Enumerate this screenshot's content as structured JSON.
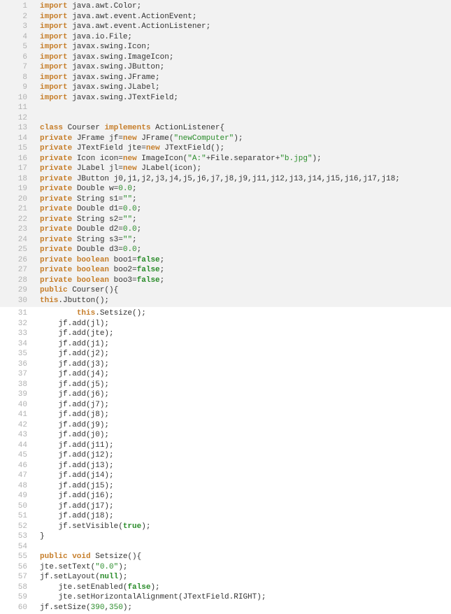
{
  "lines": [
    {
      "n": 1,
      "shaded": true,
      "indent": 0,
      "tokens": [
        [
          "kw",
          "import"
        ],
        [
          "plain",
          " java.awt.Color;"
        ]
      ]
    },
    {
      "n": 2,
      "shaded": true,
      "indent": 0,
      "tokens": [
        [
          "kw",
          "import"
        ],
        [
          "plain",
          " java.awt.event.ActionEvent;"
        ]
      ]
    },
    {
      "n": 3,
      "shaded": true,
      "indent": 0,
      "tokens": [
        [
          "kw",
          "import"
        ],
        [
          "plain",
          " java.awt.event.ActionListener;"
        ]
      ]
    },
    {
      "n": 4,
      "shaded": true,
      "indent": 0,
      "tokens": [
        [
          "kw",
          "import"
        ],
        [
          "plain",
          " java.io.File;"
        ]
      ]
    },
    {
      "n": 5,
      "shaded": true,
      "indent": 0,
      "tokens": [
        [
          "kw",
          "import"
        ],
        [
          "plain",
          " javax.swing.Icon;"
        ]
      ]
    },
    {
      "n": 6,
      "shaded": true,
      "indent": 0,
      "tokens": [
        [
          "kw",
          "import"
        ],
        [
          "plain",
          " javax.swing.ImageIcon;"
        ]
      ]
    },
    {
      "n": 7,
      "shaded": true,
      "indent": 0,
      "tokens": [
        [
          "kw",
          "import"
        ],
        [
          "plain",
          " javax.swing.JButton;"
        ]
      ]
    },
    {
      "n": 8,
      "shaded": true,
      "indent": 0,
      "tokens": [
        [
          "kw",
          "import"
        ],
        [
          "plain",
          " javax.swing.JFrame;"
        ]
      ]
    },
    {
      "n": 9,
      "shaded": true,
      "indent": 0,
      "tokens": [
        [
          "kw",
          "import"
        ],
        [
          "plain",
          " javax.swing.JLabel;"
        ]
      ]
    },
    {
      "n": 10,
      "shaded": true,
      "indent": 0,
      "tokens": [
        [
          "kw",
          "import"
        ],
        [
          "plain",
          " javax.swing.JTextField;"
        ]
      ]
    },
    {
      "n": 11,
      "shaded": true,
      "indent": 0,
      "tokens": []
    },
    {
      "n": 12,
      "shaded": true,
      "indent": 0,
      "tokens": []
    },
    {
      "n": 13,
      "shaded": true,
      "indent": 0,
      "tokens": [
        [
          "kw",
          "class"
        ],
        [
          "plain",
          " Courser "
        ],
        [
          "kw",
          "implements"
        ],
        [
          "plain",
          " ActionListener{"
        ]
      ]
    },
    {
      "n": 14,
      "shaded": true,
      "indent": 0,
      "tokens": [
        [
          "kw",
          "private"
        ],
        [
          "plain",
          " JFrame jf="
        ],
        [
          "kw",
          "new"
        ],
        [
          "plain",
          " JFrame("
        ],
        [
          "str",
          "\"newComputer\""
        ],
        [
          "plain",
          ");"
        ]
      ]
    },
    {
      "n": 15,
      "shaded": true,
      "indent": 0,
      "tokens": [
        [
          "kw",
          "private"
        ],
        [
          "plain",
          " JTextField jte="
        ],
        [
          "kw",
          "new"
        ],
        [
          "plain",
          " JTextField();"
        ]
      ]
    },
    {
      "n": 16,
      "shaded": true,
      "indent": 0,
      "tokens": [
        [
          "kw",
          "private"
        ],
        [
          "plain",
          " Icon icon="
        ],
        [
          "kw",
          "new"
        ],
        [
          "plain",
          " ImageIcon("
        ],
        [
          "str",
          "\"A:\""
        ],
        [
          "plain",
          "+File.separator+"
        ],
        [
          "str",
          "\"b.jpg\""
        ],
        [
          "plain",
          ");"
        ]
      ]
    },
    {
      "n": 17,
      "shaded": true,
      "indent": 0,
      "tokens": [
        [
          "kw",
          "private"
        ],
        [
          "plain",
          " JLabel jl="
        ],
        [
          "kw",
          "new"
        ],
        [
          "plain",
          " JLabel(icon);"
        ]
      ]
    },
    {
      "n": 18,
      "shaded": true,
      "indent": 0,
      "tokens": [
        [
          "kw",
          "private"
        ],
        [
          "plain",
          " JButton j0,j1,j2,j3,j4,j5,j6,j7,j8,j9,j11,j12,j13,j14,j15,j16,j17,j18;"
        ]
      ]
    },
    {
      "n": 19,
      "shaded": true,
      "indent": 0,
      "tokens": [
        [
          "kw",
          "private"
        ],
        [
          "plain",
          " Double w="
        ],
        [
          "num",
          "0.0"
        ],
        [
          "plain",
          ";"
        ]
      ]
    },
    {
      "n": 20,
      "shaded": true,
      "indent": 0,
      "tokens": [
        [
          "kw",
          "private"
        ],
        [
          "plain",
          " String s1="
        ],
        [
          "str",
          "\"\""
        ],
        [
          "plain",
          ";"
        ]
      ]
    },
    {
      "n": 21,
      "shaded": true,
      "indent": 0,
      "tokens": [
        [
          "kw",
          "private"
        ],
        [
          "plain",
          " Double d1="
        ],
        [
          "num",
          "0.0"
        ],
        [
          "plain",
          ";"
        ]
      ]
    },
    {
      "n": 22,
      "shaded": true,
      "indent": 0,
      "tokens": [
        [
          "kw",
          "private"
        ],
        [
          "plain",
          " String s2="
        ],
        [
          "str",
          "\"\""
        ],
        [
          "plain",
          ";"
        ]
      ]
    },
    {
      "n": 23,
      "shaded": true,
      "indent": 0,
      "tokens": [
        [
          "kw",
          "private"
        ],
        [
          "plain",
          " Double d2="
        ],
        [
          "num",
          "0.0"
        ],
        [
          "plain",
          ";"
        ]
      ]
    },
    {
      "n": 24,
      "shaded": true,
      "indent": 0,
      "tokens": [
        [
          "kw",
          "private"
        ],
        [
          "plain",
          " String s3="
        ],
        [
          "str",
          "\"\""
        ],
        [
          "plain",
          ";"
        ]
      ]
    },
    {
      "n": 25,
      "shaded": true,
      "indent": 0,
      "tokens": [
        [
          "kw",
          "private"
        ],
        [
          "plain",
          " Double d3="
        ],
        [
          "num",
          "0.0"
        ],
        [
          "plain",
          ";"
        ]
      ]
    },
    {
      "n": 26,
      "shaded": true,
      "indent": 0,
      "tokens": [
        [
          "kw",
          "private boolean"
        ],
        [
          "plain",
          " boo1="
        ],
        [
          "bool",
          "false"
        ],
        [
          "plain",
          ";"
        ]
      ]
    },
    {
      "n": 27,
      "shaded": true,
      "indent": 0,
      "tokens": [
        [
          "kw",
          "private boolean"
        ],
        [
          "plain",
          " boo2="
        ],
        [
          "bool",
          "false"
        ],
        [
          "plain",
          ";"
        ]
      ]
    },
    {
      "n": 28,
      "shaded": true,
      "indent": 0,
      "tokens": [
        [
          "kw",
          "private boolean"
        ],
        [
          "plain",
          " boo3="
        ],
        [
          "bool",
          "false"
        ],
        [
          "plain",
          ";"
        ]
      ]
    },
    {
      "n": 29,
      "shaded": true,
      "indent": 0,
      "tokens": [
        [
          "kw",
          "public"
        ],
        [
          "plain",
          " Courser(){"
        ]
      ]
    },
    {
      "n": 30,
      "shaded": true,
      "indent": 0,
      "tokens": [
        [
          "kw",
          "this"
        ],
        [
          "plain",
          ".Jbutton();"
        ]
      ]
    },
    {
      "n": 31,
      "shaded": false,
      "indent": 2,
      "tokens": [
        [
          "kw",
          "this"
        ],
        [
          "plain",
          ".Setsize();"
        ]
      ]
    },
    {
      "n": 32,
      "shaded": false,
      "indent": 1,
      "tokens": [
        [
          "plain",
          "jf.add(jl);"
        ]
      ]
    },
    {
      "n": 33,
      "shaded": false,
      "indent": 1,
      "tokens": [
        [
          "plain",
          "jf.add(jte);"
        ]
      ]
    },
    {
      "n": 34,
      "shaded": false,
      "indent": 1,
      "tokens": [
        [
          "plain",
          "jf.add(j1);"
        ]
      ]
    },
    {
      "n": 35,
      "shaded": false,
      "indent": 1,
      "tokens": [
        [
          "plain",
          "jf.add(j2);"
        ]
      ]
    },
    {
      "n": 36,
      "shaded": false,
      "indent": 1,
      "tokens": [
        [
          "plain",
          "jf.add(j3);"
        ]
      ]
    },
    {
      "n": 37,
      "shaded": false,
      "indent": 1,
      "tokens": [
        [
          "plain",
          "jf.add(j4);"
        ]
      ]
    },
    {
      "n": 38,
      "shaded": false,
      "indent": 1,
      "tokens": [
        [
          "plain",
          "jf.add(j5);"
        ]
      ]
    },
    {
      "n": 39,
      "shaded": false,
      "indent": 1,
      "tokens": [
        [
          "plain",
          "jf.add(j6);"
        ]
      ]
    },
    {
      "n": 40,
      "shaded": false,
      "indent": 1,
      "tokens": [
        [
          "plain",
          "jf.add(j7);"
        ]
      ]
    },
    {
      "n": 41,
      "shaded": false,
      "indent": 1,
      "tokens": [
        [
          "plain",
          "jf.add(j8);"
        ]
      ]
    },
    {
      "n": 42,
      "shaded": false,
      "indent": 1,
      "tokens": [
        [
          "plain",
          "jf.add(j9);"
        ]
      ]
    },
    {
      "n": 43,
      "shaded": false,
      "indent": 1,
      "tokens": [
        [
          "plain",
          "jf.add(j0);"
        ]
      ]
    },
    {
      "n": 44,
      "shaded": false,
      "indent": 1,
      "tokens": [
        [
          "plain",
          "jf.add(j11);"
        ]
      ]
    },
    {
      "n": 45,
      "shaded": false,
      "indent": 1,
      "tokens": [
        [
          "plain",
          "jf.add(j12);"
        ]
      ]
    },
    {
      "n": 46,
      "shaded": false,
      "indent": 1,
      "tokens": [
        [
          "plain",
          "jf.add(j13);"
        ]
      ]
    },
    {
      "n": 47,
      "shaded": false,
      "indent": 1,
      "tokens": [
        [
          "plain",
          "jf.add(j14);"
        ]
      ]
    },
    {
      "n": 48,
      "shaded": false,
      "indent": 1,
      "tokens": [
        [
          "plain",
          "jf.add(j15);"
        ]
      ]
    },
    {
      "n": 49,
      "shaded": false,
      "indent": 1,
      "tokens": [
        [
          "plain",
          "jf.add(j16);"
        ]
      ]
    },
    {
      "n": 50,
      "shaded": false,
      "indent": 1,
      "tokens": [
        [
          "plain",
          "jf.add(j17);"
        ]
      ]
    },
    {
      "n": 51,
      "shaded": false,
      "indent": 1,
      "tokens": [
        [
          "plain",
          "jf.add(j18);"
        ]
      ]
    },
    {
      "n": 52,
      "shaded": false,
      "indent": 1,
      "tokens": [
        [
          "plain",
          "jf.setVisible("
        ],
        [
          "bool",
          "true"
        ],
        [
          "plain",
          ");"
        ]
      ]
    },
    {
      "n": 53,
      "shaded": false,
      "indent": 0,
      "tokens": [
        [
          "plain",
          "}"
        ]
      ]
    },
    {
      "n": 54,
      "shaded": false,
      "indent": 0,
      "tokens": []
    },
    {
      "n": 55,
      "shaded": false,
      "indent": 0,
      "tokens": [
        [
          "kw",
          "public void"
        ],
        [
          "plain",
          " Setsize(){"
        ]
      ]
    },
    {
      "n": 56,
      "shaded": false,
      "indent": 0,
      "tokens": [
        [
          "plain",
          "jte.setText("
        ],
        [
          "str",
          "\"0.0\""
        ],
        [
          "plain",
          ");"
        ]
      ]
    },
    {
      "n": 57,
      "shaded": false,
      "indent": 0,
      "tokens": [
        [
          "plain",
          "jf.setLayout("
        ],
        [
          "bool",
          "null"
        ],
        [
          "plain",
          ");"
        ]
      ]
    },
    {
      "n": 58,
      "shaded": false,
      "indent": 1,
      "tokens": [
        [
          "plain",
          "jte.setEnabled("
        ],
        [
          "bool",
          "false"
        ],
        [
          "plain",
          ");"
        ]
      ]
    },
    {
      "n": 59,
      "shaded": false,
      "indent": 1,
      "tokens": [
        [
          "plain",
          "jte.setHorizontalAlignment(JTextField.RIGHT);"
        ]
      ]
    },
    {
      "n": 60,
      "shaded": false,
      "indent": 0,
      "tokens": [
        [
          "plain",
          "jf.setSize("
        ],
        [
          "num",
          "390"
        ],
        [
          "plain",
          ","
        ],
        [
          "num",
          "350"
        ],
        [
          "plain",
          ");"
        ]
      ]
    }
  ]
}
